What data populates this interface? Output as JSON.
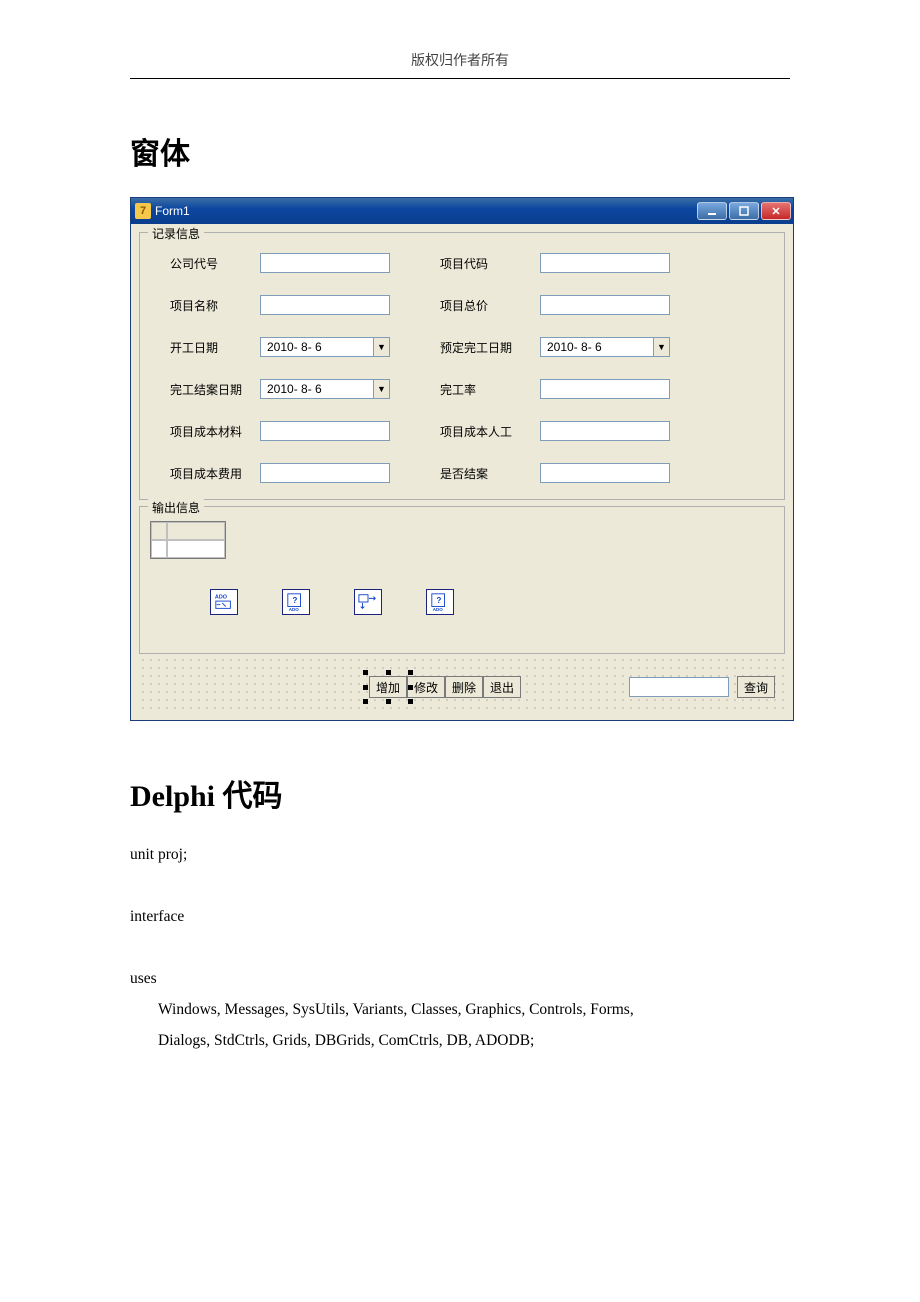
{
  "header": "版权归作者所有",
  "section1_title": "窗体",
  "window": {
    "caption": "Form1",
    "group_record": {
      "legend": "记录信息",
      "labels": {
        "company_code": "公司代号",
        "project_code": "项目代码",
        "project_name": "项目名称",
        "project_total": "项目总价",
        "start_date": "开工日期",
        "planned_end": "预定完工日期",
        "finish_date": "完工结案日期",
        "finish_rate": "完工率",
        "cost_material": "项目成本材料",
        "cost_labor": "项目成本人工",
        "cost_fee": "项目成本费用",
        "closed": "是否结案"
      },
      "dates": {
        "start": "2010- 8- 6",
        "planned_end": "2010- 8- 6",
        "finish": "2010- 8- 6"
      }
    },
    "group_output": {
      "legend": "输出信息"
    },
    "buttons": {
      "add": "增加",
      "edit": "修改",
      "delete": "删除",
      "exit": "退出",
      "query": "查询"
    }
  },
  "section2_title_latin": "Delphi ",
  "section2_title_cjk": "代码",
  "code": {
    "l1": "unit proj;",
    "l2": "interface",
    "l3": "uses",
    "l4": "Windows, Messages, SysUtils, Variants, Classes, Graphics, Controls, Forms,",
    "l5": "Dialogs, StdCtrls, Grids, DBGrids, ComCtrls, DB, ADODB;"
  }
}
